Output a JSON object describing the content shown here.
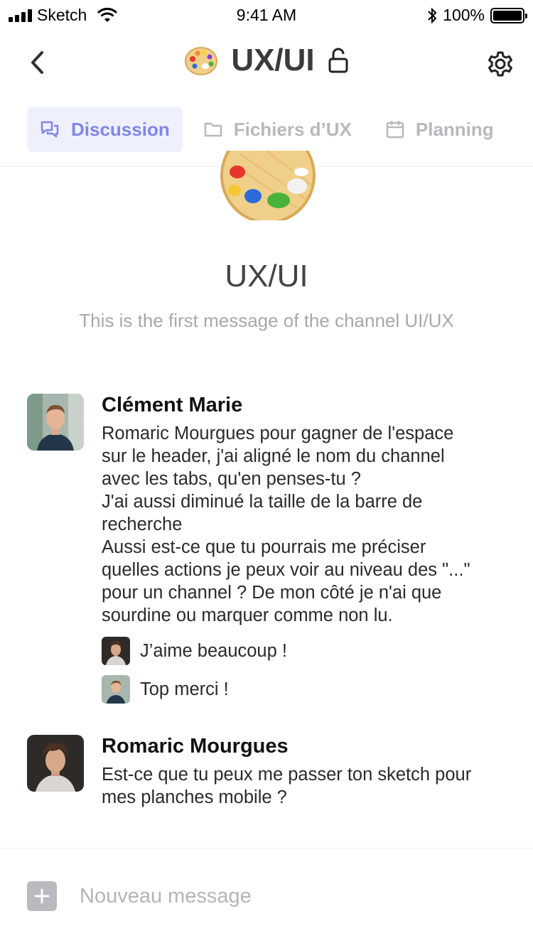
{
  "status_bar": {
    "carrier": "Sketch",
    "time": "9:41 AM",
    "battery_percent": "100%",
    "battery_level": 1.0
  },
  "header": {
    "title": "UX/UI",
    "title_icon": "artist-palette-icon",
    "lock_icon": "unlocked-padlock-icon",
    "back_icon": "chevron-left-icon",
    "settings_icon": "gear-icon"
  },
  "tabs": [
    {
      "label": "Discussion",
      "icon": "chat-bubbles-icon",
      "active": true
    },
    {
      "label": "Fichiers d’UX",
      "icon": "folder-icon",
      "active": false
    },
    {
      "label": "Planning",
      "icon": "calendar-icon",
      "active": false
    }
  ],
  "intro": {
    "channel_name": "UX/UI",
    "description": "This is the first message of the channel UI/UX"
  },
  "messages": [
    {
      "author": "Clément Marie",
      "lines": [
        "Romaric Mourgues pour gagner de l'espace",
        "sur le header, j'ai aligné le nom du channel",
        "avec les tabs, qu'en penses-tu ?",
        "J'ai aussi diminué la taille de la barre de",
        "recherche",
        "Aussi est-ce que tu pourrais me préciser",
        "quelles actions je peux voir au niveau des \"...\"",
        "pour un channel ? De mon côté je n'ai que",
        "sourdine ou marquer comme non lu."
      ],
      "replies": [
        {
          "text": "J’aime beaucoup !"
        },
        {
          "text": "Top merci !"
        }
      ]
    },
    {
      "author": "Romaric Mourgues",
      "lines": [
        "Est-ce que tu peux me passer ton sketch pour",
        "mes planches mobile ?"
      ],
      "replies": []
    }
  ],
  "composer": {
    "placeholder": "Nouveau message",
    "add_icon": "plus-icon"
  },
  "colors": {
    "accent": "#7f86e8",
    "accent_bg": "#eff0fd",
    "muted": "#b8b8bd"
  }
}
